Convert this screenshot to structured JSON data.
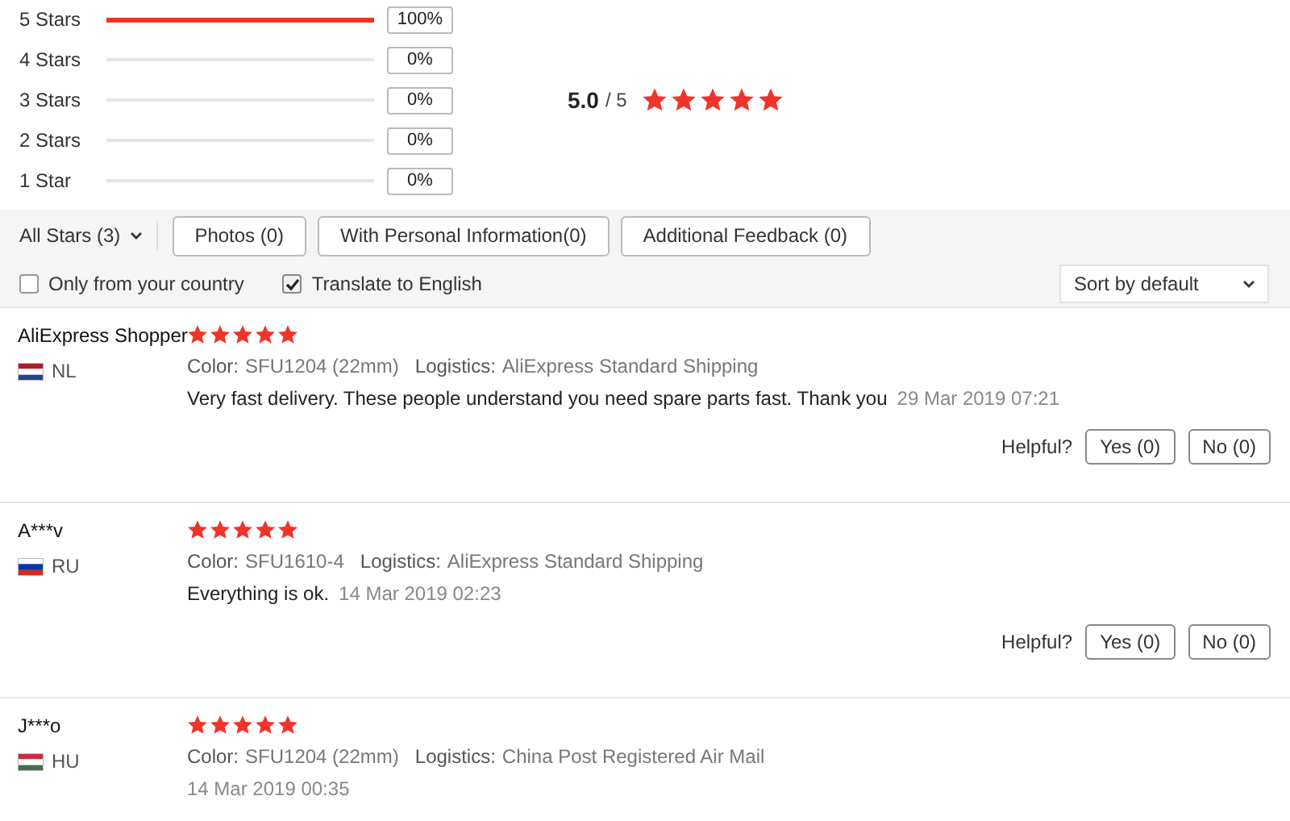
{
  "histogram": [
    {
      "label": "5 Stars",
      "level": 1,
      "percent": "100%"
    },
    {
      "label": "4 Stars",
      "level": 0,
      "percent": "0%"
    },
    {
      "label": "3 Stars",
      "level": 0,
      "percent": "0%"
    },
    {
      "label": "2 Stars",
      "level": 0,
      "percent": "0%"
    },
    {
      "label": "1 Star",
      "level": 0,
      "percent": "0%"
    }
  ],
  "summary": {
    "score": "5.0",
    "out_of": "/ 5",
    "stars": 5
  },
  "filters": {
    "dropdown": "All Stars (3)",
    "buttons": [
      "Photos (0)",
      "With Personal Information(0)",
      "Additional Feedback (0)"
    ],
    "checkboxes": [
      {
        "label": "Only from your country",
        "checked": false
      },
      {
        "label": "Translate to English",
        "checked": true
      }
    ],
    "sort": "Sort by default"
  },
  "reviews": [
    {
      "name": "AliExpress Shopper",
      "country": "NL",
      "flag": [
        {
          "color": "#ae1c28"
        },
        {
          "color": "#ffffff"
        },
        {
          "color": "#21468b"
        }
      ],
      "stars": 5,
      "color_label": "Color:",
      "color_value": "SFU1204 (22mm)",
      "logistics_label": "Logistics:",
      "logistics_value": "AliExpress Standard Shipping",
      "text": "Very fast delivery. These people understand you need spare parts fast. Thank you",
      "date": "29 Mar 2019 07:21",
      "helpful": {
        "label": "Helpful?",
        "yes": "Yes (0)",
        "no": "No (0)"
      }
    },
    {
      "name": "A***v",
      "country": "RU",
      "flag": [
        {
          "color": "#ffffff"
        },
        {
          "color": "#0039a6"
        },
        {
          "color": "#d52b1e"
        }
      ],
      "stars": 5,
      "color_label": "Color:",
      "color_value": "SFU1610-4",
      "logistics_label": "Logistics:",
      "logistics_value": "AliExpress Standard Shipping",
      "text": "Everything is ok.",
      "date": "14 Mar 2019 02:23",
      "helpful": {
        "label": "Helpful?",
        "yes": "Yes (0)",
        "no": "No (0)"
      }
    },
    {
      "name": "J***o",
      "country": "HU",
      "flag": [
        {
          "color": "#cd2a3e"
        },
        {
          "color": "#ffffff"
        },
        {
          "color": "#436f4d"
        }
      ],
      "stars": 5,
      "color_label": "Color:",
      "color_value": "SFU1204 (22mm)",
      "logistics_label": "Logistics:",
      "logistics_value": "China Post Registered Air Mail",
      "date": "14 Mar 2019 00:35"
    }
  ]
}
